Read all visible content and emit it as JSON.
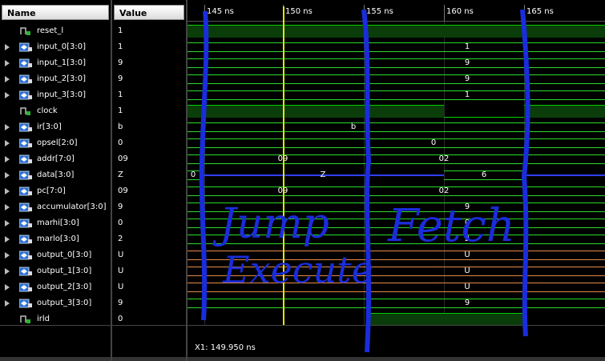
{
  "columns": {
    "name_header": "Name",
    "value_header": "Value"
  },
  "signals": [
    {
      "name": "reset_l",
      "value": "1",
      "kind": "bit",
      "expandable": false
    },
    {
      "name": "input_0[3:0]",
      "value": "1",
      "kind": "bus",
      "expandable": true
    },
    {
      "name": "input_1[3:0]",
      "value": "9",
      "kind": "bus",
      "expandable": true
    },
    {
      "name": "input_2[3:0]",
      "value": "9",
      "kind": "bus",
      "expandable": true
    },
    {
      "name": "input_3[3:0]",
      "value": "1",
      "kind": "bus",
      "expandable": true
    },
    {
      "name": "clock",
      "value": "1",
      "kind": "bit",
      "expandable": false
    },
    {
      "name": "ir[3:0]",
      "value": "b",
      "kind": "bus",
      "expandable": true
    },
    {
      "name": "opsel[2:0]",
      "value": "0",
      "kind": "bus",
      "expandable": true
    },
    {
      "name": "addr[7:0]",
      "value": "09",
      "kind": "bus",
      "expandable": true
    },
    {
      "name": "data[3:0]",
      "value": "Z",
      "kind": "bus",
      "expandable": true
    },
    {
      "name": "pc[7:0]",
      "value": "09",
      "kind": "bus",
      "expandable": true
    },
    {
      "name": "accumulator[3:0]",
      "value": "9",
      "kind": "bus",
      "expandable": true
    },
    {
      "name": "marhi[3:0]",
      "value": "0",
      "kind": "bus",
      "expandable": true
    },
    {
      "name": "marlo[3:0]",
      "value": "2",
      "kind": "bus",
      "expandable": true
    },
    {
      "name": "output_0[3:0]",
      "value": "U",
      "kind": "bus",
      "expandable": true
    },
    {
      "name": "output_1[3:0]",
      "value": "U",
      "kind": "bus",
      "expandable": true
    },
    {
      "name": "output_2[3:0]",
      "value": "U",
      "kind": "bus",
      "expandable": true
    },
    {
      "name": "output_3[3:0]",
      "value": "9",
      "kind": "bus",
      "expandable": true
    },
    {
      "name": "irld",
      "value": "0",
      "kind": "bit",
      "expandable": false
    }
  ],
  "timeline": {
    "ticks": [
      "145 ns",
      "150 ns",
      "155 ns",
      "160 ns",
      "165 ns"
    ],
    "cursor_label": "X1: 149.950 ns"
  },
  "waveform_labels": {
    "input_0": "1",
    "input_1": "9",
    "input_2": "9",
    "input_3": "1",
    "ir": "b",
    "opsel": "0",
    "addr_a": "09",
    "addr_b": "02",
    "data_a": "0",
    "data_b": "Z",
    "data_c": "6",
    "pc_a": "09",
    "pc_b": "02",
    "accumulator": "9",
    "marhi": "0",
    "marlo": "2",
    "output_0": "U",
    "output_1": "U",
    "output_2": "U",
    "output_3": "9"
  },
  "annotations": {
    "jump": "Jump",
    "execute": "Execute",
    "fetch": "Fetch"
  },
  "colors": {
    "signal_green": "#00d000",
    "signal_high_fill": "#0a3d0a",
    "bus_green": "#2adb2a",
    "undefined_orange": "#e58b4a",
    "highz_blue": "#3040ff",
    "cursor_yellow": "#e6e600",
    "ink_blue": "#1a2ddc"
  }
}
